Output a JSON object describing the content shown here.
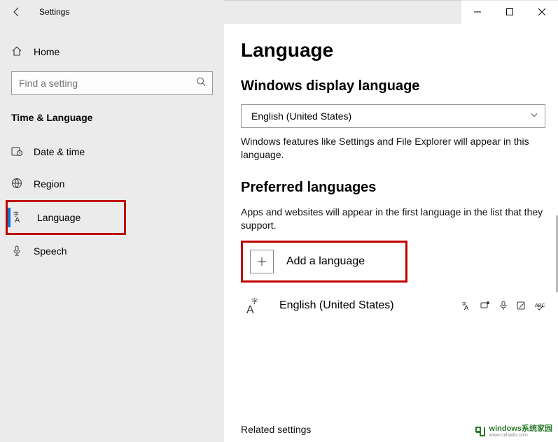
{
  "titlebar": {
    "title": "Settings"
  },
  "sidebar": {
    "home": "Home",
    "search_placeholder": "Find a setting",
    "category": "Time & Language",
    "items": [
      {
        "label": "Date & time"
      },
      {
        "label": "Region"
      },
      {
        "label": "Language"
      },
      {
        "label": "Speech"
      }
    ]
  },
  "content": {
    "page_title": "Language",
    "display_lang_heading": "Windows display language",
    "display_lang_value": "English (United States)",
    "display_lang_desc": "Windows features like Settings and File Explorer will appear in this language.",
    "preferred_heading": "Preferred languages",
    "preferred_desc": "Apps and websites will appear in the first language in the list that they support.",
    "add_language": "Add a language",
    "languages": [
      {
        "name": "English (United States)"
      }
    ],
    "related_heading": "Related settings"
  },
  "watermark": {
    "text": "windows系统家园",
    "sub": "www.ruihadu.com"
  }
}
